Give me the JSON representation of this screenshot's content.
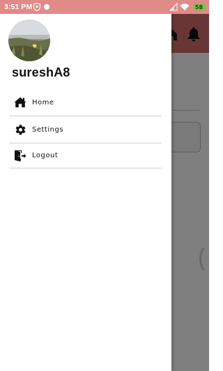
{
  "status_bar": {
    "time": "3:51 PM",
    "battery_level": "58",
    "icons": [
      "shield-icon",
      "notification-dot-icon",
      "signal-icon",
      "wifi-icon",
      "battery-icon"
    ]
  },
  "drawer": {
    "username": "sureshA8",
    "avatar_alt": "profile-photo",
    "menu": [
      {
        "label": "Home",
        "icon": "home-icon"
      },
      {
        "label": "Settings",
        "icon": "gear-icon"
      },
      {
        "label": "Logout",
        "icon": "logout-icon"
      }
    ]
  },
  "background_app": {
    "appbar_icons": [
      "home-icon",
      "bell-icon"
    ]
  },
  "colors": {
    "status_bar": "#e08a8a",
    "appbar": "#d26d6d",
    "drawer_bg": "#ffffff",
    "battery": "#7dc542",
    "text": "#111111",
    "divider": "#cfcfcf"
  }
}
